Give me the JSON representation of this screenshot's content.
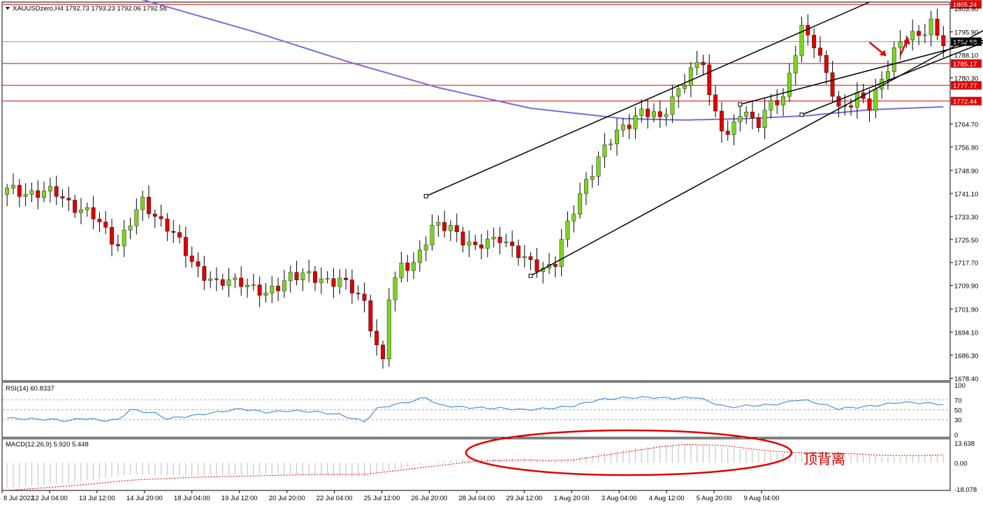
{
  "colors": {
    "up": "#7ed321",
    "down": "#e00000",
    "ma": "#7b6cd8",
    "hline": "#e00000",
    "price_line": "#7f9bbd",
    "rsi": "#2a7fd4",
    "macd_hist": "#c8c8c8",
    "macd_signal": "#e00000",
    "ellipse": "#e00000",
    "trendline": "#000000",
    "arrow": "#e00000",
    "grid": "#000000",
    "text": "#000000"
  },
  "chart_data": [
    {
      "type": "candlestick",
      "title": "XAUUSDzero,H4",
      "ohlc_label": "1792.73 1793.23 1792.06 1792.58",
      "y_ticks": [
        "1803.90",
        "1795.90",
        "1788.10",
        "1780.30",
        "1764.70",
        "1756.90",
        "1748.90",
        "1741.10",
        "1733.30",
        "1725.50",
        "1717.70",
        "1709.90",
        "1701.90",
        "1694.10",
        "1686.30",
        "1678.40"
      ],
      "ylim": [
        1677.6,
        1806.0
      ],
      "x_ticks": [
        "8 Jul 2022",
        "12 Jul 04:00",
        "13 Jul 12:00",
        "14 Jul 20:00",
        "18 Jul 04:00",
        "19 Jul 12:00",
        "20 Jul 20:00",
        "22 Jul 04:00",
        "25 Jul 12:00",
        "26 Jul 20:00",
        "28 Jul 04:00",
        "29 Jul 12:00",
        "1 Aug 20:00",
        "3 Aug 04:00",
        "4 Aug 12:00",
        "5 Aug 20:00",
        "9 Aug 04:00"
      ],
      "current_price": "1792.58",
      "levels": [
        "1805.24",
        "1785.17",
        "1777.77",
        "1772.44"
      ],
      "close_points": [
        [
          0,
          1742
        ],
        [
          8,
          1741
        ],
        [
          14,
          1733
        ],
        [
          18,
          1724
        ],
        [
          22,
          1738
        ],
        [
          26,
          1730
        ],
        [
          30,
          1718
        ],
        [
          34,
          1710
        ],
        [
          38,
          1712
        ],
        [
          42,
          1706
        ],
        [
          46,
          1714
        ],
        [
          50,
          1712
        ],
        [
          54,
          1712
        ],
        [
          58,
          1704
        ],
        [
          60,
          1690
        ],
        [
          61,
          1684
        ],
        [
          62,
          1706
        ],
        [
          64,
          1716
        ],
        [
          66,
          1718
        ],
        [
          69,
          1729
        ],
        [
          72,
          1730
        ],
        [
          76,
          1722
        ],
        [
          80,
          1727
        ],
        [
          84,
          1718
        ],
        [
          87,
          1716
        ],
        [
          89,
          1718
        ],
        [
          91,
          1730
        ],
        [
          94,
          1746
        ],
        [
          97,
          1756
        ],
        [
          100,
          1764
        ],
        [
          103,
          1769
        ],
        [
          106,
          1766
        ],
        [
          108,
          1774
        ],
        [
          111,
          1782
        ],
        [
          113,
          1786
        ],
        [
          114,
          1774
        ],
        [
          117,
          1760
        ],
        [
          119,
          1768
        ],
        [
          122,
          1766
        ],
        [
          124,
          1772
        ],
        [
          126,
          1772
        ],
        [
          128,
          1790
        ],
        [
          129,
          1798
        ],
        [
          131,
          1792
        ],
        [
          132,
          1786
        ],
        [
          135,
          1770
        ],
        [
          138,
          1774
        ],
        [
          140,
          1770
        ],
        [
          142,
          1780
        ],
        [
          144,
          1790
        ],
        [
          146,
          1794
        ],
        [
          148,
          1794
        ],
        [
          150,
          1800
        ],
        [
          151,
          1795
        ],
        [
          152,
          1792.58
        ]
      ],
      "moving_average": [
        [
          0,
          1812
        ],
        [
          20,
          1808
        ],
        [
          40,
          1796
        ],
        [
          55,
          1786
        ],
        [
          70,
          1777
        ],
        [
          85,
          1770
        ],
        [
          100,
          1766.5
        ],
        [
          110,
          1766
        ],
        [
          120,
          1766.5
        ],
        [
          130,
          1767.5
        ],
        [
          140,
          1769.5
        ],
        [
          152,
          1770.5
        ]
      ],
      "trendlines": [
        {
          "from": [
            68,
            1740.2
          ],
          "to": [
            140,
            1806
          ]
        },
        {
          "from": [
            85,
            1713.2
          ],
          "to": [
            167,
            1806
          ]
        },
        {
          "from": [
            119,
            1771.3
          ],
          "to": [
            182,
            1806
          ]
        },
        {
          "from": [
            129,
            1767.8
          ],
          "to": [
            175,
            1806
          ]
        }
      ]
    },
    {
      "type": "line",
      "title": "RSI(14) 60.8337",
      "y_ticks": [
        "100",
        "70",
        "50",
        "30",
        "0"
      ],
      "levels": [
        70,
        50,
        30
      ],
      "ylim": [
        0,
        100
      ],
      "points": [
        [
          0,
          33
        ],
        [
          8,
          30
        ],
        [
          10,
          27
        ],
        [
          12,
          33
        ],
        [
          16,
          28
        ],
        [
          18,
          30
        ],
        [
          20,
          50
        ],
        [
          24,
          43
        ],
        [
          26,
          32
        ],
        [
          30,
          38
        ],
        [
          34,
          45
        ],
        [
          38,
          52
        ],
        [
          42,
          45
        ],
        [
          46,
          48
        ],
        [
          50,
          46
        ],
        [
          54,
          40
        ],
        [
          58,
          26
        ],
        [
          60,
          52
        ],
        [
          62,
          58
        ],
        [
          66,
          68
        ],
        [
          68,
          75
        ],
        [
          70,
          60
        ],
        [
          73,
          56
        ],
        [
          76,
          54
        ],
        [
          80,
          53
        ],
        [
          84,
          50
        ],
        [
          87,
          52
        ],
        [
          89,
          54
        ],
        [
          92,
          58
        ],
        [
          96,
          70
        ],
        [
          100,
          74
        ],
        [
          104,
          75
        ],
        [
          108,
          73
        ],
        [
          112,
          75
        ],
        [
          114,
          66
        ],
        [
          117,
          55
        ],
        [
          120,
          58
        ],
        [
          124,
          60
        ],
        [
          126,
          63
        ],
        [
          128,
          70
        ],
        [
          130,
          68
        ],
        [
          132,
          62
        ],
        [
          135,
          52
        ],
        [
          138,
          55
        ],
        [
          140,
          57
        ],
        [
          142,
          60
        ],
        [
          145,
          65
        ],
        [
          148,
          64
        ],
        [
          152,
          61
        ]
      ]
    },
    {
      "type": "bar",
      "title": "MACD(12,26,9) 5.920 5.448",
      "y_ticks": [
        "13.638",
        "0.00",
        "-18.078"
      ],
      "ylim": [
        -18.078,
        13.638
      ],
      "annotation": "顶背离",
      "hist_points": [
        [
          0,
          -17
        ],
        [
          10,
          -14
        ],
        [
          20,
          -8
        ],
        [
          30,
          -9
        ],
        [
          40,
          -8
        ],
        [
          50,
          -8
        ],
        [
          58,
          -10
        ],
        [
          62,
          -5
        ],
        [
          70,
          1
        ],
        [
          76,
          3
        ],
        [
          84,
          3
        ],
        [
          88,
          1
        ],
        [
          92,
          3
        ],
        [
          100,
          9
        ],
        [
          106,
          12
        ],
        [
          110,
          13
        ],
        [
          116,
          11
        ],
        [
          120,
          9
        ],
        [
          124,
          7
        ],
        [
          128,
          6
        ],
        [
          132,
          7
        ],
        [
          136,
          6
        ],
        [
          140,
          5
        ],
        [
          144,
          4
        ],
        [
          148,
          5
        ],
        [
          152,
          5.9
        ]
      ],
      "signal_points": [
        [
          0,
          -19
        ],
        [
          10,
          -16
        ],
        [
          20,
          -12
        ],
        [
          30,
          -10
        ],
        [
          40,
          -9
        ],
        [
          50,
          -8
        ],
        [
          58,
          -8
        ],
        [
          62,
          -6
        ],
        [
          70,
          -2
        ],
        [
          76,
          1
        ],
        [
          84,
          2
        ],
        [
          88,
          1.5
        ],
        [
          92,
          2
        ],
        [
          100,
          7
        ],
        [
          106,
          11
        ],
        [
          110,
          12.5
        ],
        [
          116,
          12
        ],
        [
          120,
          10
        ],
        [
          124,
          8
        ],
        [
          128,
          7
        ],
        [
          132,
          7
        ],
        [
          136,
          6.5
        ],
        [
          140,
          5.5
        ],
        [
          144,
          5
        ],
        [
          148,
          5
        ],
        [
          152,
          5.4
        ]
      ]
    }
  ]
}
